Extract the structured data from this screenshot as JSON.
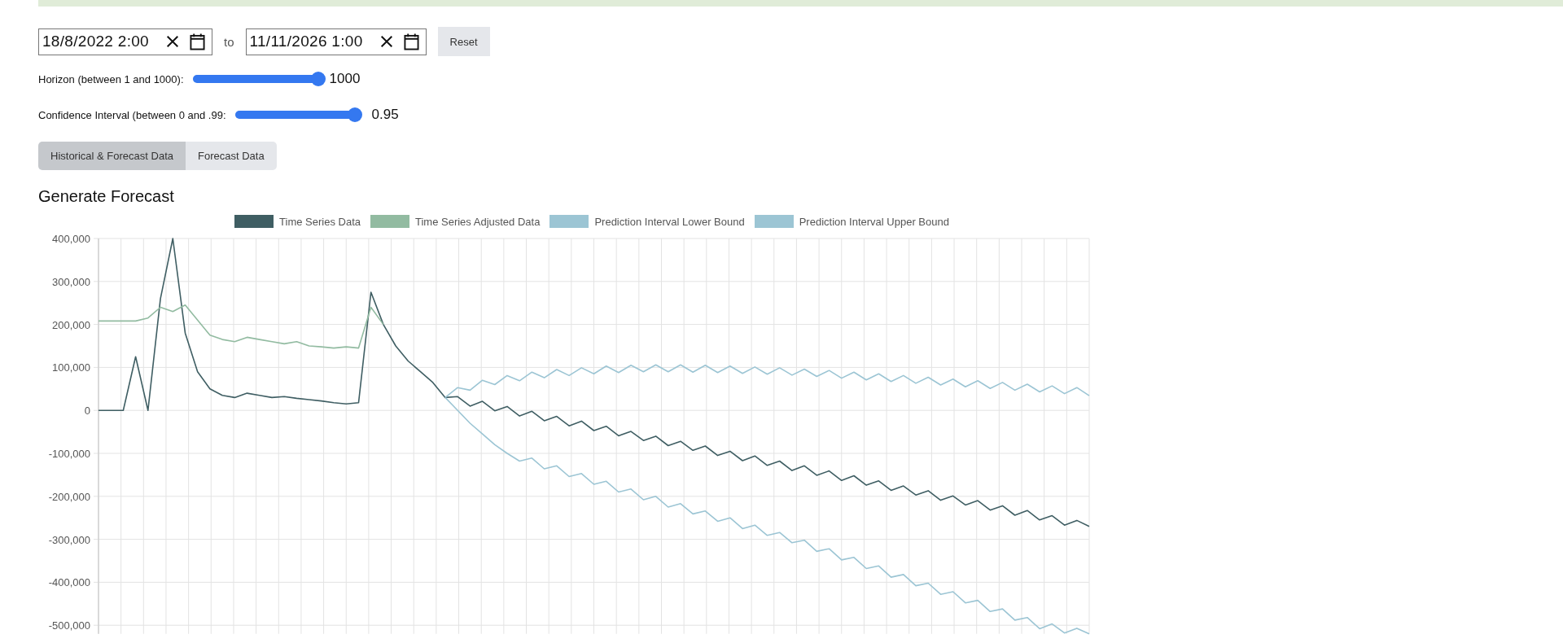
{
  "date_range": {
    "start": {
      "value": "18/8/2022 2:00"
    },
    "separator": "to",
    "end": {
      "value": "11/11/2026 1:00"
    }
  },
  "reset_button": "Reset",
  "sliders": [
    {
      "label": "Horizon (between 1 and 1000):",
      "level": 1,
      "reading": "1000"
    },
    {
      "label": "Confidence Interval (between 0 and .99:",
      "level": 0.96,
      "reading": "0.95"
    }
  ],
  "tabs": [
    {
      "label": "Historical & Forecast Data",
      "selected": true
    },
    {
      "label": "Forecast Data",
      "selected": false
    }
  ],
  "heading": "Generate Forecast",
  "chart": {
    "chart_data": {
      "type": "line",
      "grid": true,
      "legend": true,
      "ylim": [
        -520000,
        400000
      ],
      "yticks": [
        {
          "value": 400000,
          "label": "400,000"
        },
        {
          "value": 300000,
          "label": "300,000"
        },
        {
          "value": 200000,
          "label": "200,000"
        },
        {
          "value": 100000,
          "label": "100,000"
        },
        {
          "value": 0,
          "label": "0"
        },
        {
          "value": -100000,
          "label": "-100,000"
        },
        {
          "value": -200000,
          "label": "-200,000"
        },
        {
          "value": -300000,
          "label": "-300,000"
        },
        {
          "value": -400000,
          "label": "-400,000"
        },
        {
          "value": -500000,
          "label": "-500,000"
        }
      ],
      "series": [
        {
          "name": "Time Series Data",
          "color": "#3f5e63",
          "values": [
            0,
            0,
            0,
            125000,
            0,
            260000,
            400000,
            180000,
            90000,
            50000,
            35000,
            30000,
            40000,
            35000,
            30000,
            32000,
            28000,
            25000,
            22000,
            18000,
            15000,
            18000,
            275000,
            200000,
            150000,
            115000,
            90000,
            65000,
            30000,
            32000,
            10000,
            21000,
            -1000,
            9000,
            -13000,
            -2000,
            -24000,
            -14000,
            -36000,
            -25000,
            -47000,
            -37000,
            -59000,
            -49000,
            -70000,
            -60000,
            -82000,
            -72000,
            -93000,
            -83000,
            -105000,
            -95000,
            -117000,
            -106000,
            -128000,
            -118000,
            -140000,
            -129000,
            -151000,
            -141000,
            -163000,
            -152000,
            -174000,
            -164000,
            -186000,
            -176000,
            -197000,
            -187000,
            -209000,
            -199000,
            -220000,
            -210000,
            -232000,
            -222000,
            -244000,
            -233000,
            -255000,
            -245000,
            -267000,
            -256000,
            -270000
          ]
        },
        {
          "name": "Time Series Adjusted Data",
          "color": "#92bba1",
          "values": [
            208000,
            208000,
            208000,
            208000,
            215000,
            240000,
            230000,
            245000,
            210000,
            175000,
            165000,
            160000,
            170000,
            165000,
            160000,
            155000,
            160000,
            150000,
            148000,
            145000,
            148000,
            145000,
            240000,
            200000,
            null,
            null,
            null,
            null,
            null,
            null,
            null,
            null,
            null,
            null,
            null,
            null,
            null,
            null,
            null,
            null,
            null,
            null,
            null,
            null,
            null,
            null,
            null,
            null,
            null,
            null,
            null,
            null,
            null,
            null,
            null,
            null,
            null,
            null,
            null,
            null,
            null,
            null,
            null,
            null,
            null,
            null,
            null,
            null,
            null,
            null,
            null,
            null,
            null,
            null,
            null,
            null,
            null,
            null,
            null,
            null,
            null
          ]
        },
        {
          "name": "Prediction Interval Lower Bound",
          "color": "#9cc5d4",
          "values": [
            null,
            null,
            null,
            null,
            null,
            null,
            null,
            null,
            null,
            null,
            null,
            null,
            null,
            null,
            null,
            null,
            null,
            null,
            null,
            null,
            null,
            null,
            null,
            null,
            null,
            null,
            null,
            null,
            30000,
            0,
            -30000,
            -55000,
            -80000,
            -100000,
            -118000,
            -111000,
            -136000,
            -129000,
            -154000,
            -147000,
            -172000,
            -165000,
            -190000,
            -183000,
            -208000,
            -200000,
            -225000,
            -217000,
            -241000,
            -234000,
            -258000,
            -250000,
            -275000,
            -267000,
            -291000,
            -284000,
            -308000,
            -302000,
            -328000,
            -322000,
            -348000,
            -342000,
            -368000,
            -362000,
            -388000,
            -382000,
            -408000,
            -402000,
            -428000,
            -422000,
            -448000,
            -442000,
            -468000,
            -462000,
            -488000,
            -482000,
            -508000,
            -497000,
            -518000,
            -507000,
            -520000
          ]
        },
        {
          "name": "Prediction Interval Upper Bound",
          "color": "#9cc5d4",
          "values": [
            null,
            null,
            null,
            null,
            null,
            null,
            null,
            null,
            null,
            null,
            null,
            null,
            null,
            null,
            null,
            null,
            null,
            null,
            null,
            null,
            null,
            null,
            null,
            null,
            null,
            null,
            null,
            null,
            30000,
            53000,
            47000,
            70000,
            60000,
            81000,
            69000,
            89000,
            76000,
            95000,
            81000,
            99000,
            85000,
            103000,
            88000,
            105000,
            90000,
            106000,
            90000,
            106000,
            89000,
            105000,
            88000,
            103000,
            86000,
            101000,
            84000,
            99000,
            82000,
            96000,
            79000,
            93000,
            75000,
            89000,
            71000,
            85000,
            67000,
            81000,
            63000,
            77000,
            59000,
            73000,
            55000,
            69000,
            51000,
            65000,
            47000,
            61000,
            43000,
            57000,
            39000,
            53000,
            34000
          ]
        }
      ]
    }
  }
}
